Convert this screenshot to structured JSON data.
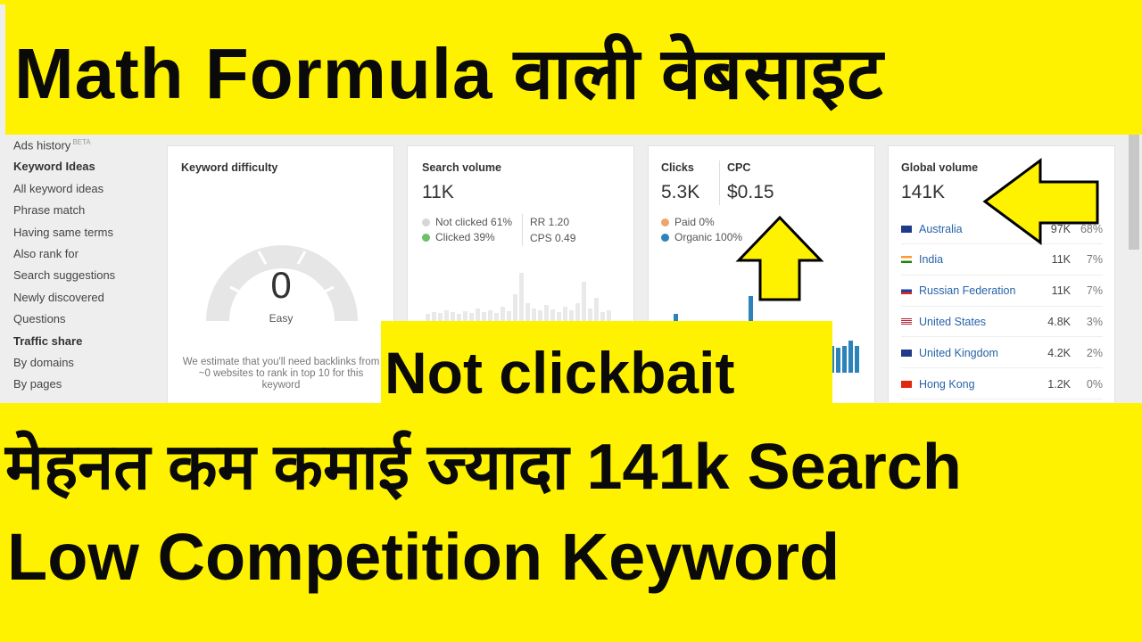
{
  "sidebar": {
    "items": [
      {
        "label": "Ads history",
        "badge": "BETA",
        "type": "link"
      },
      {
        "label": "Keyword Ideas",
        "type": "head"
      },
      {
        "label": "All keyword ideas",
        "type": "link"
      },
      {
        "label": "Phrase match",
        "type": "link"
      },
      {
        "label": "Having same terms",
        "type": "link"
      },
      {
        "label": "Also rank for",
        "type": "link"
      },
      {
        "label": "Search suggestions",
        "type": "link"
      },
      {
        "label": "Newly discovered",
        "type": "link"
      },
      {
        "label": "Questions",
        "type": "link"
      },
      {
        "label": "Traffic share",
        "type": "head"
      },
      {
        "label": "By domains",
        "type": "link"
      },
      {
        "label": "By pages",
        "type": "link"
      }
    ]
  },
  "keyword_difficulty": {
    "title": "Keyword difficulty",
    "value": "0",
    "label": "Easy",
    "note": "We estimate that you'll need backlinks from ~0 websites to rank in top 10 for this keyword",
    "gauge_fraction": 0
  },
  "search_volume": {
    "title": "Search volume",
    "value": "11K",
    "not_clicked": "Not clicked 61%",
    "clicked": "Clicked 39%",
    "rr": "RR 1.20",
    "cps": "CPS 0.49",
    "colors": {
      "not_clicked": "#d6d6d6",
      "clicked": "#6cc06b"
    }
  },
  "clicks": {
    "title": "Clicks",
    "value": "5.3K",
    "cpc_title": "CPC",
    "cpc_value": "$0.15",
    "paid": "Paid 0%",
    "organic": "Organic 100%",
    "colors": {
      "paid": "#f0a46c",
      "organic": "#2b83ba"
    }
  },
  "global_volume": {
    "title": "Global volume",
    "value": "141K",
    "countries": [
      {
        "name": "Australia",
        "volume": "97K",
        "percent": "68%",
        "flag": "au"
      },
      {
        "name": "India",
        "volume": "11K",
        "percent": "7%",
        "flag": "in"
      },
      {
        "name": "Russian Federation",
        "volume": "11K",
        "percent": "7%",
        "flag": "ru"
      },
      {
        "name": "United States",
        "volume": "4.8K",
        "percent": "3%",
        "flag": "us"
      },
      {
        "name": "United Kingdom",
        "volume": "4.2K",
        "percent": "2%",
        "flag": "gb"
      },
      {
        "name": "Hong Kong",
        "volume": "1.2K",
        "percent": "0%",
        "flag": "hk"
      }
    ]
  },
  "overlay": {
    "top_text": "Math Formula वाली वेबसाइट",
    "mid_text": "Not clickbait",
    "bottom_line1": "मेहनत कम कमाई ज्यादा 141k Search",
    "bottom_line2": "Low Competition Keyword",
    "accent": "#fff200"
  }
}
